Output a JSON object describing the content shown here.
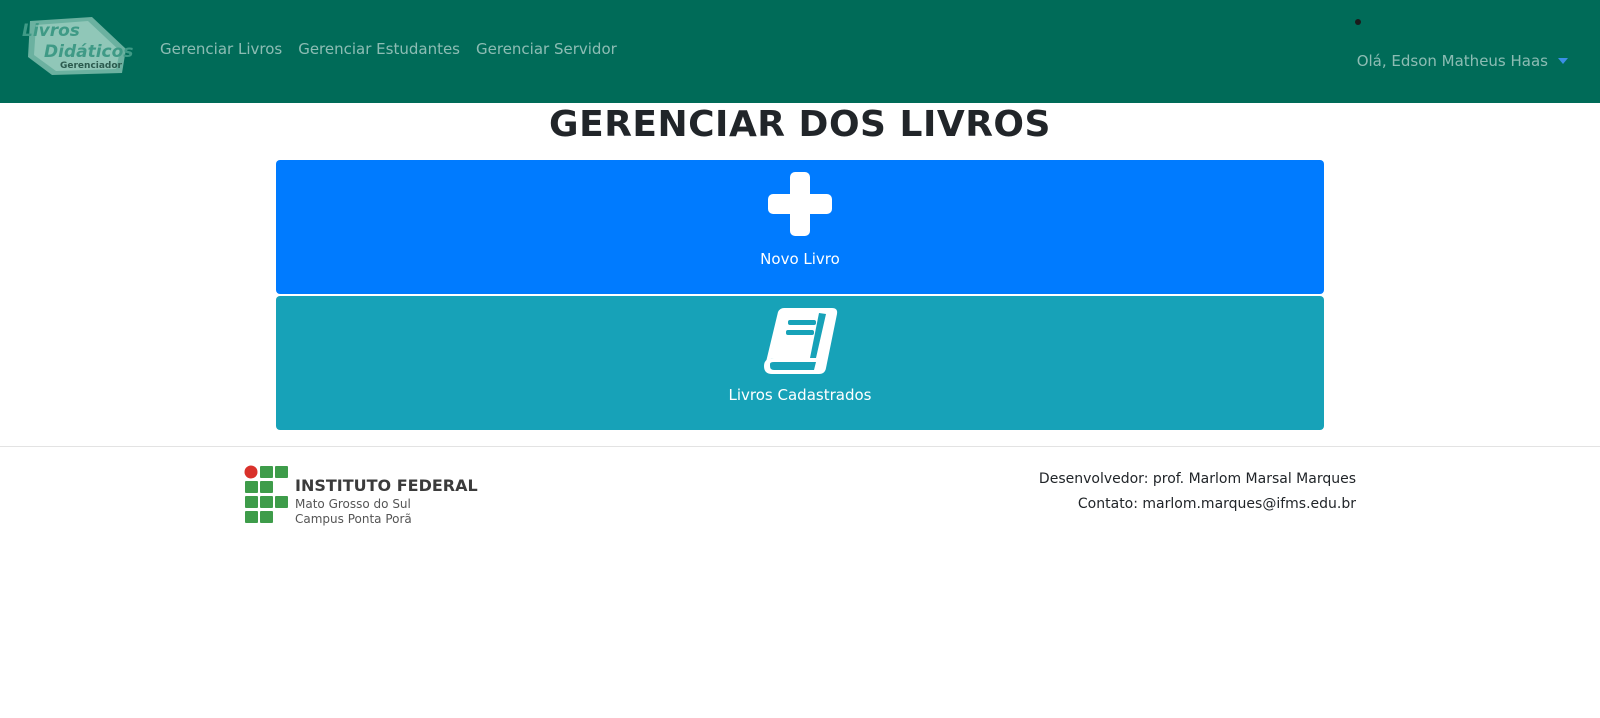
{
  "navbar": {
    "brand": {
      "line1": "Livros",
      "line2": "Didáticos",
      "line3": "Gerenciador"
    },
    "links": [
      {
        "label": "Gerenciar Livros"
      },
      {
        "label": "Gerenciar Estudantes"
      },
      {
        "label": "Gerenciar Servidor"
      }
    ],
    "user_menu_label": "Olá, Edson Matheus Haas"
  },
  "main": {
    "title": "GERENCIAR DOS LIVROS",
    "actions": [
      {
        "label": "Novo Livro",
        "icon": "plus-icon",
        "color": "#007bff"
      },
      {
        "label": "Livros Cadastrados",
        "icon": "book-icon",
        "color": "#17a2b8"
      }
    ]
  },
  "footer": {
    "logo": {
      "title": "INSTITUTO FEDERAL",
      "subtitle1": "Mato Grosso do Sul",
      "subtitle2": "Campus Ponta Porã"
    },
    "developer": "Desenvolvedor: prof. Marlom Marsal Marques",
    "contact": "Contato: marlom.marques@ifms.edu.br"
  },
  "colors": {
    "navbar": "#006b58",
    "primary": "#007bff",
    "info": "#17a2b8",
    "logo_green": "#3e9c4a",
    "logo_red": "#d9312b"
  }
}
